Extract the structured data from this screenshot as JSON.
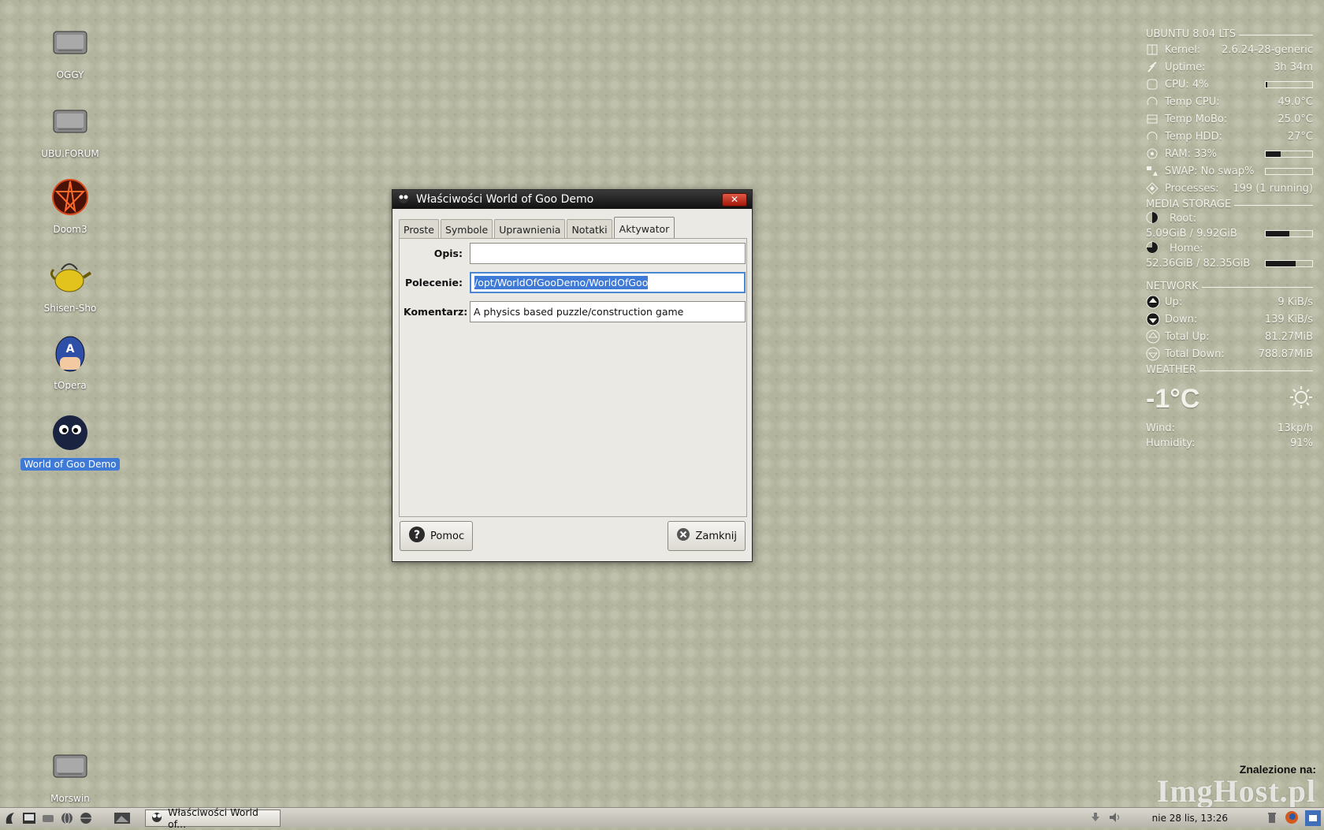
{
  "desktop": {
    "icons": [
      {
        "label": "OGGY",
        "icon": "drive-icon"
      },
      {
        "label": "UBU.FORUM",
        "icon": "drive-icon"
      },
      {
        "label": "Doom3",
        "icon": "pentagram-icon"
      },
      {
        "label": "Shisen-Sho",
        "icon": "teapot-icon"
      },
      {
        "label": "tOpera",
        "icon": "captain-america-icon"
      },
      {
        "label": "World of Goo Demo",
        "icon": "goo-ball-icon"
      },
      {
        "label": "Morswin",
        "icon": "drive-icon"
      }
    ]
  },
  "conky": {
    "system": {
      "header": "UBUNTU 8.04 LTS",
      "kernel_label": "Kernel:",
      "kernel": "2.6.24-28-generic",
      "uptime_label": "Uptime:",
      "uptime": "3h 34m",
      "cpu_label": "CPU: 4%",
      "cpu_pct": 4,
      "temp_cpu_label": "Temp CPU:",
      "temp_cpu": "49.0°C",
      "temp_mobo_label": "Temp MoBo:",
      "temp_mobo": "25.0°C",
      "temp_hdd_label": "Temp HDD:",
      "temp_hdd": "27°C",
      "ram_label": "RAM: 33%",
      "ram_pct": 33,
      "swap_label": "SWAP: No swap%",
      "swap_pct": 0,
      "processes_label": "Processes:",
      "processes": "199 (1 running)"
    },
    "storage": {
      "header": "MEDIA STORAGE",
      "root_label": "Root:",
      "root_usage": "5.09GiB / 9.92GiB",
      "root_pct": 51,
      "home_label": "Home:",
      "home_usage": "52.36GiB / 82.35GiB",
      "home_pct": 64
    },
    "network": {
      "header": "NETWORK",
      "up_label": "Up:",
      "up": "9 KiB/s",
      "down_label": "Down:",
      "down": "139 KiB/s",
      "total_up_label": "Total Up:",
      "total_up": "81.27MiB",
      "total_down_label": "Total Down:",
      "total_down": "788.87MiB"
    },
    "weather": {
      "header": "WEATHER",
      "temperature": "-1°C",
      "icon": "sun-icon",
      "wind_label": "Wind:",
      "wind": "13kp/h",
      "humidity_label": "Humidity:",
      "humidity": "91%"
    }
  },
  "dialog": {
    "title": "Właściwości World of Goo Demo",
    "tabs": [
      "Proste",
      "Symbole",
      "Uprawnienia",
      "Notatki",
      "Aktywator"
    ],
    "active_tab": "Aktywator",
    "fields": {
      "opis_label": "Opis:",
      "opis_value": "",
      "polecenie_label": "Polecenie:",
      "polecenie_value": "/opt/WorldOfGooDemo/WorldOfGoo",
      "komentarz_label": "Komentarz:",
      "komentarz_value": "A physics based puzzle/construction game"
    },
    "help_button": "Pomoc",
    "close_button": "Zamknij"
  },
  "taskbar": {
    "task_title": "Właściwości World of...",
    "clock": "nie 28 lis, 13:26"
  },
  "watermark": {
    "line1": "Znalezione na:",
    "line2": "ImgHost.pl"
  }
}
